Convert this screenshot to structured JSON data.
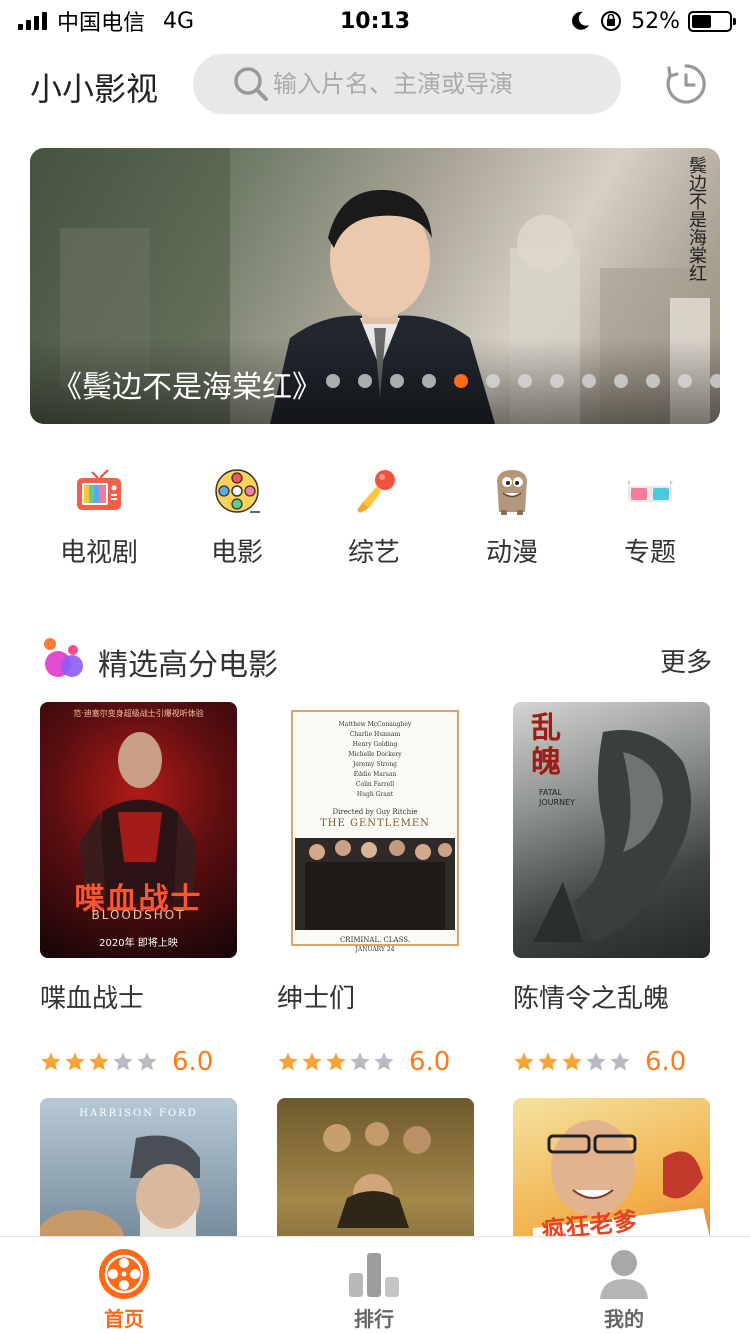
{
  "status_bar": {
    "carrier": "中国电信",
    "network": "4G",
    "time": "10:13",
    "battery_percent": "52%",
    "battery_level": 0.52
  },
  "header": {
    "app_title": "小小影视",
    "search_placeholder": "输入片名、主演或导演",
    "search_icon": "search-icon",
    "history_icon": "history-icon"
  },
  "banner": {
    "title": "《鬓边不是海棠红》",
    "corner_text": "鬓边不是海棠红",
    "dot_count": 13,
    "active_dot": 4,
    "active_color": "#ff6a1a"
  },
  "categories": [
    {
      "label": "电视剧",
      "icon": "tv-icon"
    },
    {
      "label": "电影",
      "icon": "film-reel-icon"
    },
    {
      "label": "综艺",
      "icon": "microphone-icon"
    },
    {
      "label": "动漫",
      "icon": "cartoon-icon"
    },
    {
      "label": "专题",
      "icon": "3d-glasses-icon"
    }
  ],
  "section": {
    "title": "精选高分电影",
    "more": "更多"
  },
  "movies": [
    {
      "title": "喋血战士",
      "rating": "6.0",
      "stars": 3,
      "poster_texts": {
        "top": "范·迪塞尔变身超级战士引爆视听体验",
        "main": "喋血战士",
        "sub": "BLOODSHOT",
        "date": "2020年 即将上映"
      }
    },
    {
      "title": "绅士们",
      "rating": "6.0",
      "stars": 3,
      "poster_texts": {
        "cast": [
          "Matthew McConaughey",
          "Charlie Hunnam",
          "Henry Golding",
          "Michelle Dockery",
          "Jeremy Strong",
          "Eddie Marsan",
          "Colin Farrell",
          "Hugh Grant"
        ],
        "director": "Directed by Guy Ritchie",
        "main": "THE GENTLEMEN",
        "tagline": "CRIMINAL. CLASS.",
        "date": "JANUARY 24"
      }
    },
    {
      "title": "陈情令之乱魄",
      "rating": "6.0",
      "stars": 3,
      "poster_texts": {
        "main": "乱魄",
        "sub": "FATAL JOURNEY"
      }
    },
    {
      "title": "",
      "rating": "",
      "stars": 0,
      "poster_texts": {
        "top": "HARRISON FORD"
      }
    },
    {
      "title": "",
      "rating": "",
      "stars": 0,
      "poster_texts": {}
    },
    {
      "title": "",
      "rating": "",
      "stars": 0,
      "poster_texts": {
        "main": "疯狂老爹"
      }
    }
  ],
  "tabs": [
    {
      "label": "首页",
      "icon": "film-reel-icon",
      "active": true
    },
    {
      "label": "排行",
      "icon": "ranking-icon",
      "active": false
    },
    {
      "label": "我的",
      "icon": "user-icon",
      "active": false
    }
  ],
  "colors": {
    "accent": "#ff6a1a",
    "star_on": "#f6a33a",
    "star_off": "#b9b9c4"
  }
}
